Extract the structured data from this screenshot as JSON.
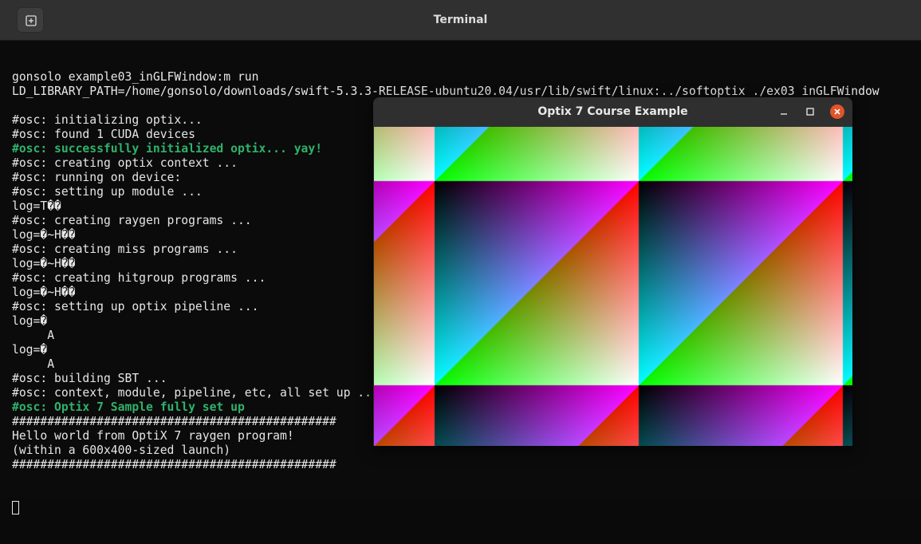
{
  "terminal": {
    "title": "Terminal",
    "lines": [
      {
        "text": "gonsolo example03_inGLFWindow:m run",
        "style": "normal"
      },
      {
        "text": "LD_LIBRARY_PATH=/home/gonsolo/downloads/swift-5.3.3-RELEASE-ubuntu20.04/usr/lib/swift/linux:../softoptix ./ex03_inGLFWindow",
        "style": "normal"
      },
      {
        "text": "",
        "style": "normal"
      },
      {
        "text": "#osc: initializing optix...",
        "style": "normal"
      },
      {
        "text": "#osc: found 1 CUDA devices",
        "style": "normal"
      },
      {
        "text": "#osc: successfully initialized optix... yay!",
        "style": "green"
      },
      {
        "text": "#osc: creating optix context ...",
        "style": "normal"
      },
      {
        "text": "#osc: running on device:",
        "style": "normal"
      },
      {
        "text": "#osc: setting up module ...",
        "style": "normal"
      },
      {
        "text": "log=T��",
        "style": "normal"
      },
      {
        "text": "#osc: creating raygen programs ...",
        "style": "normal"
      },
      {
        "text": "log=�~H��",
        "style": "normal"
      },
      {
        "text": "#osc: creating miss programs ...",
        "style": "normal"
      },
      {
        "text": "log=�~H��",
        "style": "normal"
      },
      {
        "text": "#osc: creating hitgroup programs ...",
        "style": "normal"
      },
      {
        "text": "log=�~H��",
        "style": "normal"
      },
      {
        "text": "#osc: setting up optix pipeline ...",
        "style": "normal"
      },
      {
        "text": "log=�",
        "style": "normal"
      },
      {
        "text": "     A",
        "style": "normal"
      },
      {
        "text": "log=�",
        "style": "normal"
      },
      {
        "text": "     A",
        "style": "normal"
      },
      {
        "text": "#osc: building SBT ...",
        "style": "normal"
      },
      {
        "text": "#osc: context, module, pipeline, etc, all set up ...",
        "style": "normal"
      },
      {
        "text": "#osc: Optix 7 Sample fully set up",
        "style": "green"
      },
      {
        "text": "##############################################",
        "style": "normal"
      },
      {
        "text": "Hello world from OptiX 7 raygen program!",
        "style": "normal"
      },
      {
        "text": "(within a 600x400-sized launch)",
        "style": "normal"
      },
      {
        "text": "##############################################",
        "style": "normal"
      }
    ]
  },
  "optix_window": {
    "title": "Optix 7 Course Example",
    "controls": [
      "minimize-icon",
      "maximize-icon",
      "close-icon"
    ],
    "close_color": "#e2542a"
  },
  "colors": {
    "terminal_bg": "#0b0b0b",
    "terminal_text": "#e6e6e6",
    "green_text": "#2fb26b",
    "titlebar": "#303030"
  }
}
